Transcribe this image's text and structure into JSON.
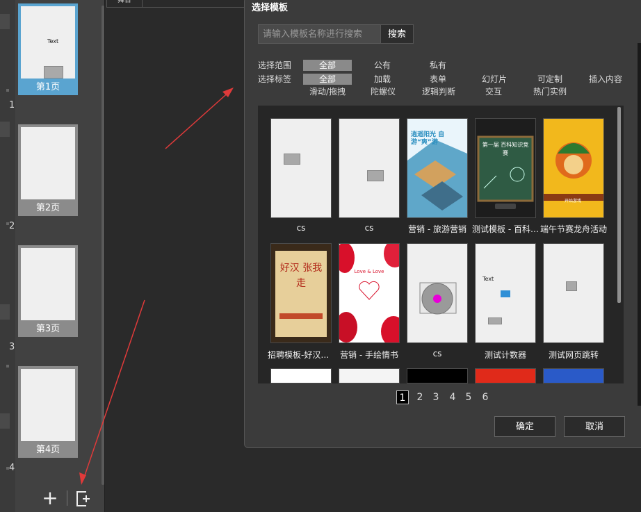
{
  "stage": {
    "tab_label": "舞台"
  },
  "pages": [
    {
      "num": "1",
      "label": "第1页",
      "thumb_text": "Text"
    },
    {
      "num": "2",
      "label": "第2页"
    },
    {
      "num": "3",
      "label": "第3页"
    },
    {
      "num": "4",
      "label": "第4页"
    }
  ],
  "dialog": {
    "title": "选择模板",
    "search": {
      "placeholder": "请输入模板名称进行搜索",
      "button": "搜索"
    },
    "scope": {
      "label": "选择范围",
      "options": [
        "全部",
        "公有",
        "私有"
      ],
      "selected": "全部"
    },
    "tags": {
      "label": "选择标签",
      "options": [
        "全部",
        "加载",
        "表单",
        "幻灯片",
        "可定制",
        "插入内容",
        "滑动/拖拽",
        "陀螺仪",
        "逻辑判断",
        "交互",
        "热门实例"
      ],
      "selected": "全部"
    },
    "templates": [
      {
        "name": "cs"
      },
      {
        "name": "cs"
      },
      {
        "name": "营销 - 旅游营销",
        "art_text": "逍遥阳光 自游“爽”游"
      },
      {
        "name": "测试模板 - 百科知识竞赛",
        "art_text": "第一届 百科知识竞赛"
      },
      {
        "name": "端午节赛龙舟活动",
        "art_text": "开始游戏"
      },
      {
        "name": "招聘模板-好汉张我走",
        "art_text": "好汉 张我走"
      },
      {
        "name": "营销 - 手绘情书",
        "art_text": "Love & Love"
      },
      {
        "name": "cs"
      },
      {
        "name": "测试计数器",
        "art_text": "Text"
      },
      {
        "name": "测试网页跳转"
      }
    ],
    "pagination": [
      "1",
      "2",
      "3",
      "4",
      "5",
      "6"
    ],
    "current_page": "1",
    "confirm": "确定",
    "cancel": "取消"
  },
  "colors": {
    "accent": "#5aa4d0",
    "dialog_bg": "#3b3b3b",
    "arrow": "#e03a3a"
  }
}
